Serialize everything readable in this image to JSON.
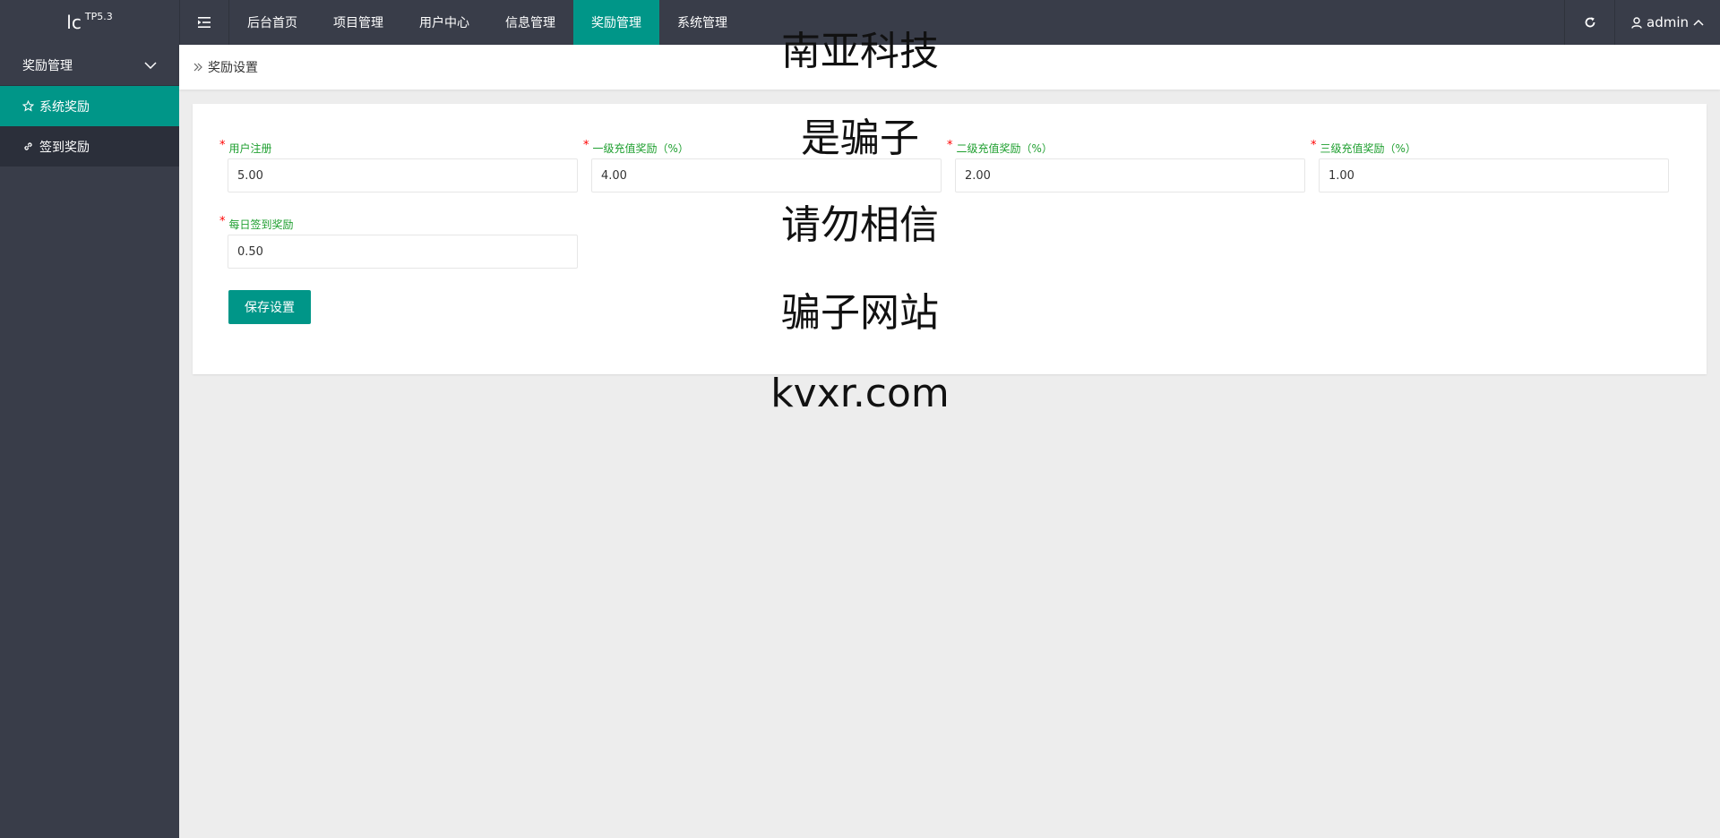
{
  "logo": {
    "text": "lc",
    "version": "TP5.3"
  },
  "topnav": {
    "items": [
      {
        "label": "后台首页"
      },
      {
        "label": "项目管理"
      },
      {
        "label": "用户中心"
      },
      {
        "label": "信息管理"
      },
      {
        "label": "奖励管理"
      },
      {
        "label": "系统管理"
      }
    ],
    "active_index": 4
  },
  "user": {
    "name": "admin"
  },
  "sidebar": {
    "group_label": "奖励管理",
    "items": [
      {
        "label": "系统奖励",
        "icon": "star-icon"
      },
      {
        "label": "签到奖励",
        "icon": "link-icon"
      }
    ]
  },
  "breadcrumb": {
    "current": "奖励设置"
  },
  "form": {
    "fields": [
      {
        "label": "用户注册",
        "value": "5.00"
      },
      {
        "label": "一级充值奖励（%）",
        "value": "4.00"
      },
      {
        "label": "二级充值奖励（%）",
        "value": "2.00"
      },
      {
        "label": "三级充值奖励（%）",
        "value": "1.00"
      },
      {
        "label": "每日签到奖励",
        "value": "0.50"
      }
    ],
    "required_mark": "*",
    "save_label": "保存设置"
  },
  "watermark": {
    "lines": [
      "南亚科技",
      "是骗子",
      "请勿相信",
      "骗子网站",
      "kvxr.com"
    ]
  },
  "colors": {
    "header_bg": "#393d49",
    "accent": "#009688",
    "label_green": "#1e9f2f",
    "required_red": "#ff0000"
  }
}
